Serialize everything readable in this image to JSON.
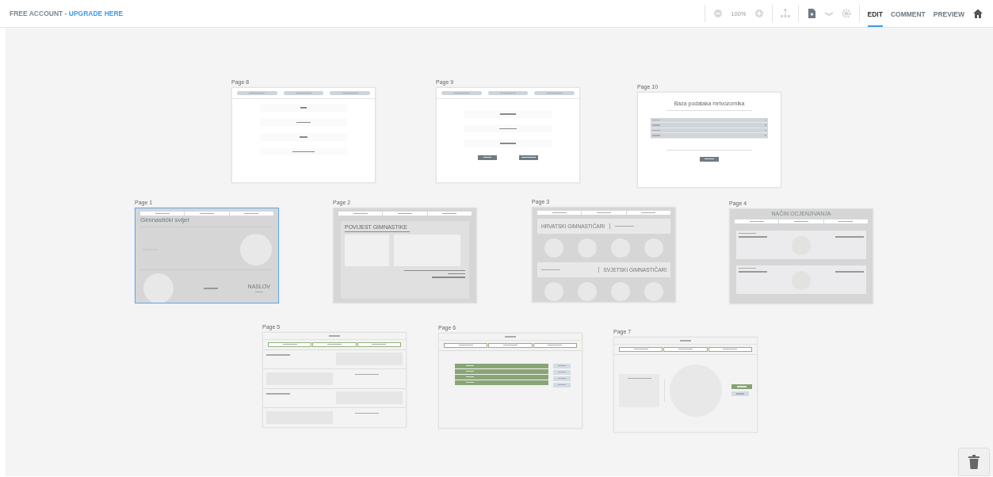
{
  "topbar": {
    "account": "FREE ACCOUNT - ",
    "upgrade_link": "UPGRADE HERE",
    "zoom": "100%",
    "tabs": [
      {
        "label": "EDIT",
        "selected": true
      },
      {
        "label": "COMMENT",
        "selected": false
      },
      {
        "label": "PREVIEW",
        "selected": false
      }
    ]
  },
  "pages": [
    {
      "title": "Page 8",
      "kind": "personal_form",
      "selected": false
    },
    {
      "title": "Page 9",
      "kind": "death_form",
      "selected": false
    },
    {
      "title": "Page 10",
      "kind": "database",
      "selected": false,
      "heading": "Baza podataka mrtvozornika"
    },
    {
      "title": "Page 1",
      "kind": "home",
      "selected": true,
      "heading": "Gimnastički svijet",
      "caption_title": "NASLOV"
    },
    {
      "title": "Page 2",
      "kind": "history",
      "selected": false,
      "heading": "POVIJEST GIMNASTIKE"
    },
    {
      "title": "Page 3",
      "kind": "gymnasts",
      "selected": false,
      "sections": [
        {
          "heading": "HRVATSKI GIMNASTIČARI"
        },
        {
          "heading": "SVJETSKI GIMNASTIČARI"
        }
      ]
    },
    {
      "title": "Page 4",
      "kind": "grading",
      "selected": false,
      "heading": "NAČIN OCJENJIVANJA"
    },
    {
      "title": "Page 5",
      "kind": "sections",
      "selected": false
    },
    {
      "title": "Page 6",
      "kind": "list",
      "selected": false
    },
    {
      "title": "Page 7",
      "kind": "detail",
      "selected": false
    }
  ]
}
